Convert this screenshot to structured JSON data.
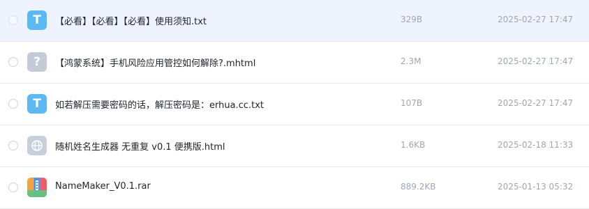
{
  "files": [
    {
      "name": "【必看】【必看】【必看】使用须知.txt",
      "size": "329B",
      "date": "2025-02-27 17:47",
      "icon": "txt-file-icon",
      "icon_glyph": "T"
    },
    {
      "name": "【鸿蒙系统】手机风险应用管控如何解除?.mhtml",
      "size": "2.3M",
      "date": "2025-02-27 17:47",
      "icon": "unknown-file-icon",
      "icon_glyph": "?"
    },
    {
      "name": "如若解压需要密码的话，解压密码是：erhua.cc.txt",
      "size": "107B",
      "date": "2025-02-27 17:47",
      "icon": "txt-file-icon",
      "icon_glyph": "T"
    },
    {
      "name": "随机姓名生成器 无重复 v0.1 便携版.html",
      "size": "1.6KB",
      "date": "2025-02-18 11:33",
      "icon": "html-file-icon"
    },
    {
      "name": "NameMaker_V0.1.rar",
      "size": "889.2KB",
      "date": "2025-01-13 05:32",
      "icon": "rar-archive-icon"
    }
  ],
  "colors": {
    "selected_row_bg": "#eef3fe",
    "txt_icon": "#5ab8f3",
    "unknown_icon": "#c3cbd7",
    "html_icon": "#c7cfdc"
  }
}
